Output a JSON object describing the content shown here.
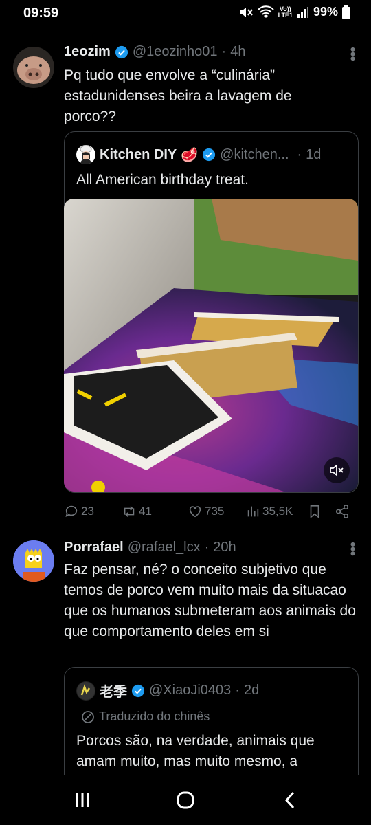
{
  "status_bar": {
    "time": "09:59",
    "lte_top": "Vo))",
    "lte_bottom": "LTE1",
    "battery": "99%"
  },
  "tweet1": {
    "name": "1eozim",
    "handle": "@1eozinho01",
    "sep": "·",
    "time": "4h",
    "text": "Pq tudo que envolve a “culinária” estadunidenses beira a lavagem de porco??",
    "quote": {
      "name": "Kitchen DIY",
      "name_emoji": "🥩",
      "handle": "@kitchen...",
      "sep": "·",
      "time": "1d",
      "text": "All American birthday treat."
    },
    "actions": {
      "replies": "23",
      "retweets": "41",
      "likes": "735",
      "views": "35,5K"
    }
  },
  "tweet2": {
    "name": "Porrafael",
    "handle": "@rafael_lcx",
    "sep": "·",
    "time": "20h",
    "text": "Faz pensar, né? o conceito subjetivo que temos de porco vem muito mais da situacao que os humanos submeteram aos animais do que comportamento deles em si",
    "quote": {
      "name": "老季",
      "handle": "@XiaoJi0403",
      "sep": "·",
      "time": "2d",
      "translated": "Traduzido do chinês",
      "text": "Porcos são, na verdade, animais que amam muito, mas muito mesmo, a"
    }
  },
  "colors": {
    "background": "#000000",
    "text": "#e7e9ea",
    "muted": "#71767b",
    "verified": "#1d9bf0",
    "border": "#2f3336"
  },
  "icons": [
    "wifi-icon",
    "signal-icon",
    "battery-icon",
    "verified-icon",
    "reply-icon",
    "retweet-icon",
    "like-icon",
    "views-icon",
    "bookmark-icon",
    "share-icon",
    "mute-icon",
    "globe-icon",
    "recents-icon",
    "home-icon",
    "back-icon"
  ]
}
